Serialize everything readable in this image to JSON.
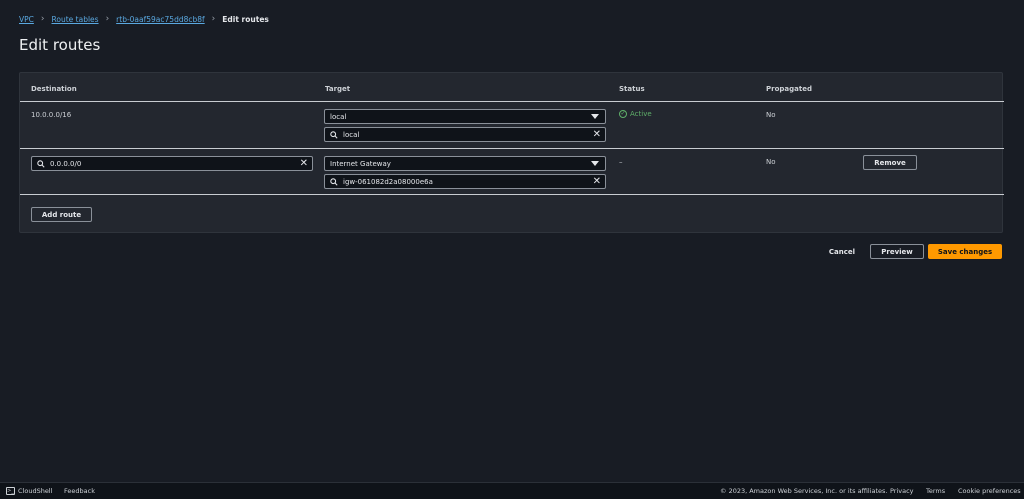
{
  "breadcrumb": {
    "items": [
      "VPC",
      "Route tables",
      "rtb-0aaf59ac75dd8cb8f"
    ],
    "current": "Edit routes"
  },
  "page_title": "Edit routes",
  "table": {
    "headers": {
      "destination": "Destination",
      "target": "Target",
      "status": "Status",
      "propagated": "Propagated"
    },
    "rows": [
      {
        "destination": "10.0.0.0/16",
        "target_select": "local",
        "target_search": "local",
        "status": "Active",
        "propagated": "No"
      },
      {
        "destination": "0.0.0.0/0",
        "target_select": "Internet Gateway",
        "target_search": "igw-061082d2a08000e6a",
        "status": "–",
        "propagated": "No",
        "remove_label": "Remove"
      }
    ],
    "add_route_label": "Add route"
  },
  "actions": {
    "cancel": "Cancel",
    "preview": "Preview",
    "save": "Save changes"
  },
  "footer": {
    "cloudshell": "CloudShell",
    "feedback": "Feedback",
    "copyright": "© 2023, Amazon Web Services, Inc. or its affiliates.",
    "privacy": "Privacy",
    "terms": "Terms",
    "cookie": "Cookie preferences"
  },
  "colors": {
    "background": "#181c24",
    "panel": "#23272f",
    "primary": "#ff9900",
    "link": "#5aa8e0",
    "success": "#5fb06a"
  }
}
